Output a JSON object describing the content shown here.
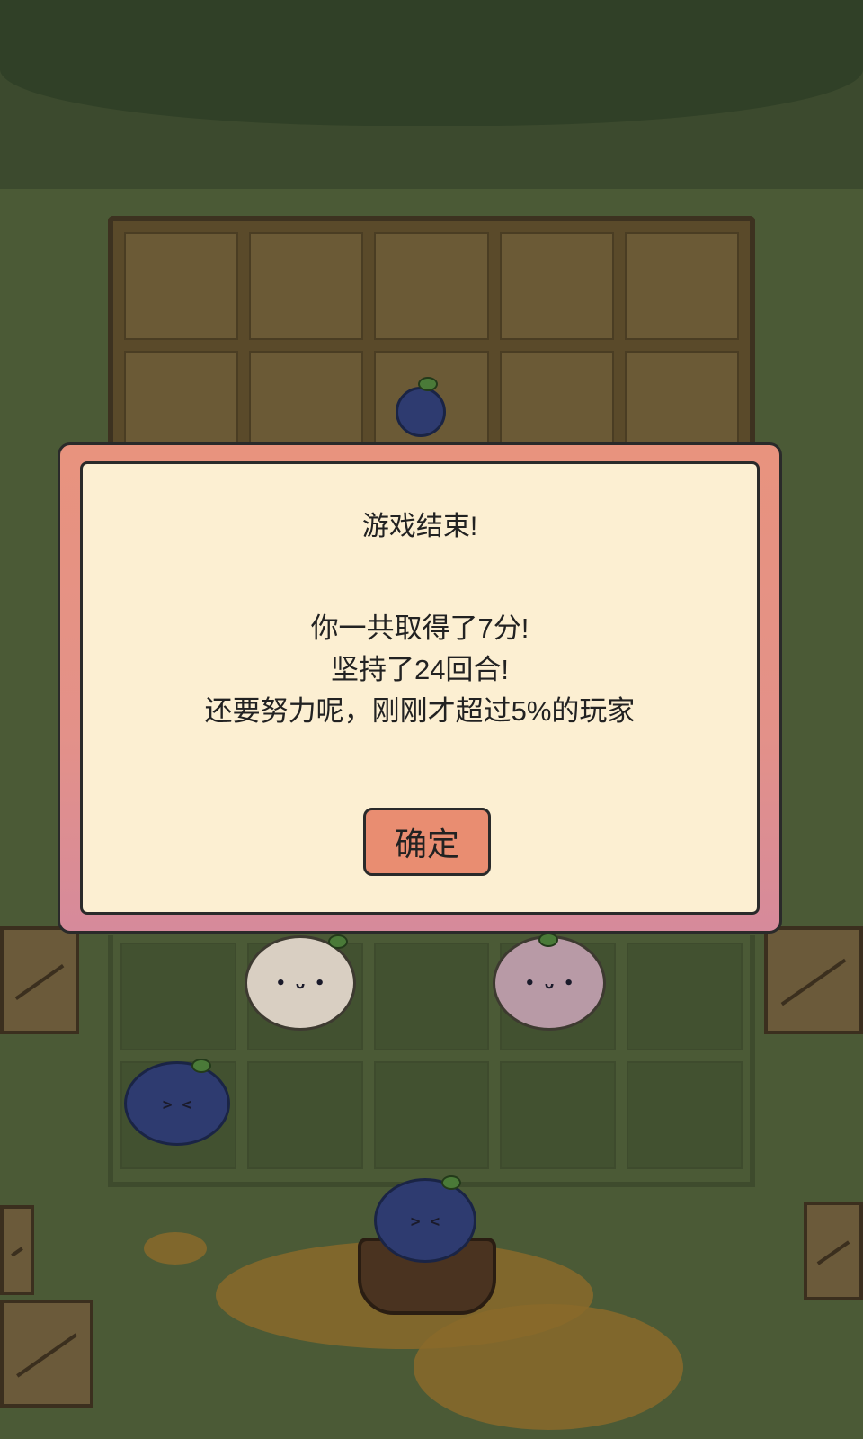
{
  "dialog": {
    "title": "游戏结束!",
    "score_line": "你一共取得了7分!",
    "rounds_line": "坚持了24回合!",
    "rank_line": "还要努力呢，刚刚才超过5%的玩家",
    "confirm_label": "确定"
  },
  "colors": {
    "dialog_frame": "#e8937e",
    "dialog_panel": "#fcefd2",
    "confirm_button": "#e98d71"
  }
}
